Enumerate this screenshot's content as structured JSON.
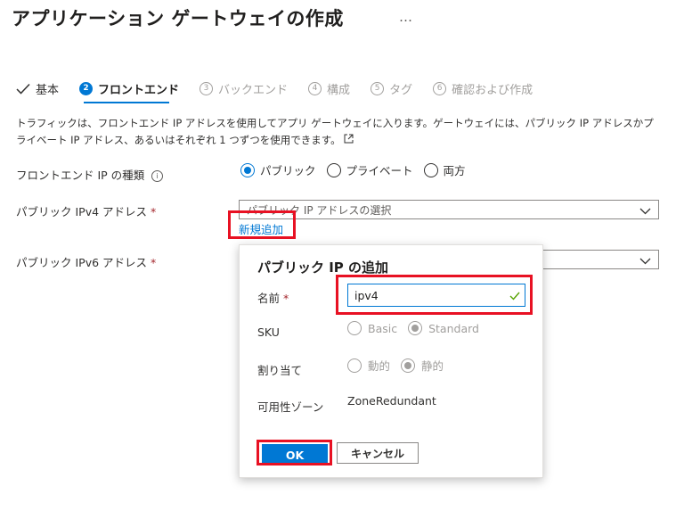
{
  "header": {
    "title": "アプリケーション ゲートウェイの作成",
    "more": "…"
  },
  "steps": [
    {
      "label": "基本",
      "state": "done"
    },
    {
      "num": "2",
      "label": "フロントエンド",
      "state": "active"
    },
    {
      "num": "3",
      "label": "バックエンド",
      "state": "pending"
    },
    {
      "num": "4",
      "label": "構成",
      "state": "pending"
    },
    {
      "num": "5",
      "label": "タグ",
      "state": "pending"
    },
    {
      "num": "6",
      "label": "確認および作成",
      "state": "pending"
    }
  ],
  "description": "トラフィックは、フロントエンド IP アドレスを使用してアプリ ゲートウェイに入ります。ゲートウェイには、パブリック IP アドレスかプライベート IP アドレス、あるいはそれぞれ 1 つずつを使用できます。",
  "form": {
    "ip_type_label": "フロントエンド IP の種類",
    "ip_type_options": [
      "パブリック",
      "プライベート",
      "両方"
    ],
    "ip_type_selected": "パブリック",
    "ipv4_label": "パブリック IPv4 アドレス",
    "ipv4_placeholder": "パブリック IP アドレスの選択",
    "new_link": "新規追加",
    "ipv6_label": "パブリック IPv6 アドレス",
    "required_mark": "*"
  },
  "dialog": {
    "title": "パブリック IP の追加",
    "name_label": "名前",
    "name_value": "ipv4",
    "sku_label": "SKU",
    "sku_options": [
      "Basic",
      "Standard"
    ],
    "sku_selected": "Standard",
    "assign_label": "割り当て",
    "assign_options": [
      "動的",
      "静的"
    ],
    "assign_selected": "静的",
    "zone_label": "可用性ゾーン",
    "zone_value": "ZoneRedundant",
    "ok_label": "OK",
    "cancel_label": "キャンセル"
  },
  "colors": {
    "accent": "#0078d4",
    "highlight": "#e81123",
    "required": "#a4262c",
    "valid": "#57a300"
  }
}
